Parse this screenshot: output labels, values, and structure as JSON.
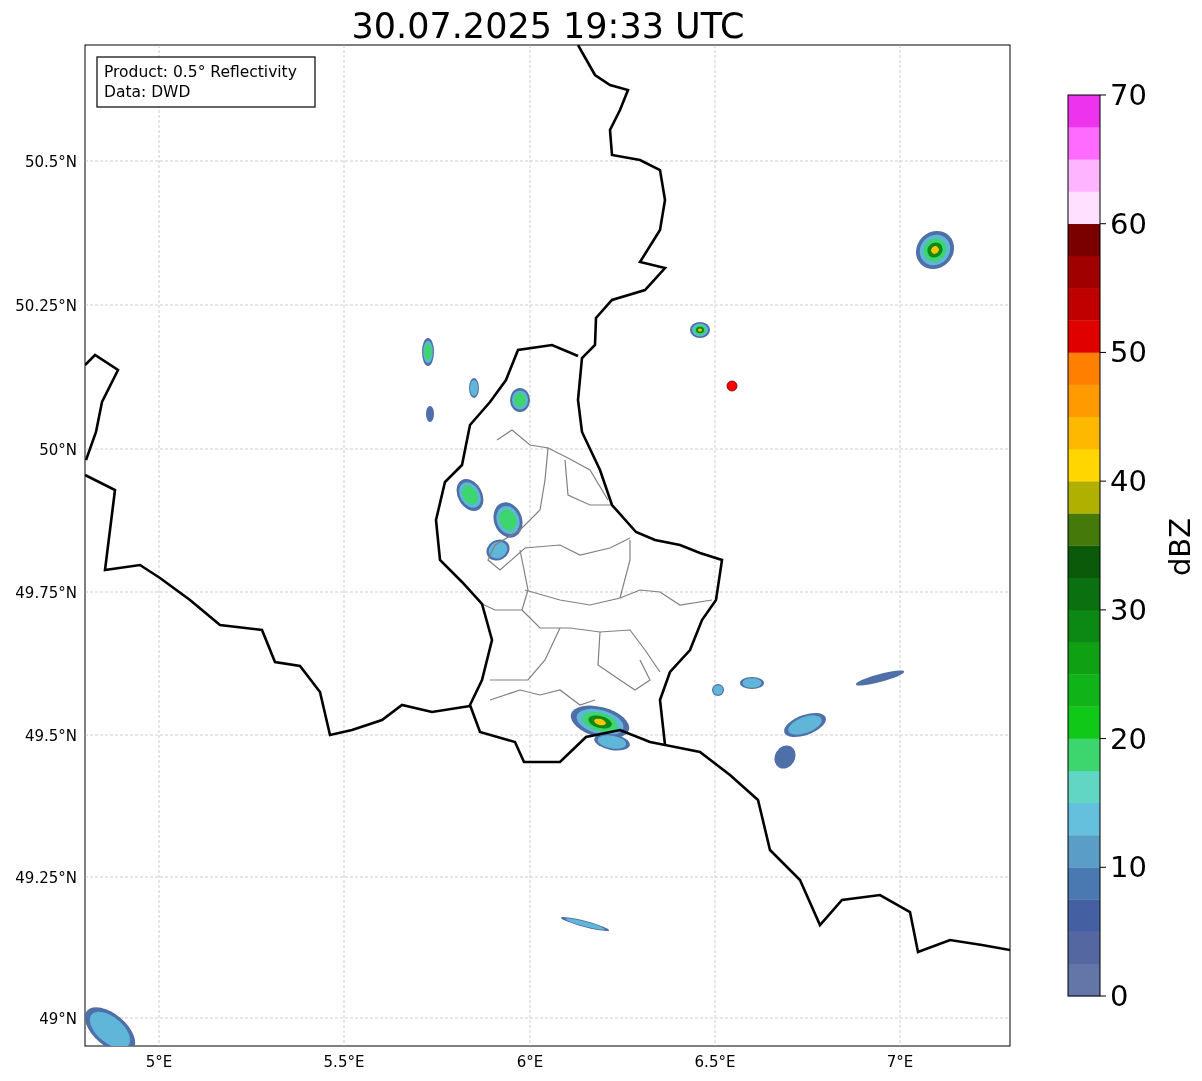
{
  "title": "30.07.2025 19:33 UTC",
  "info_box": {
    "lines": [
      "Product: 0.5° Reflectivity",
      "Data: DWD"
    ]
  },
  "map": {
    "lat_labels": [
      "50.5°N",
      "50.25°N",
      "50°N",
      "49.75°N",
      "49.5°N",
      "49.25°N",
      "49°N"
    ],
    "lon_labels": [
      "5°E",
      "5.5°E",
      "6°E",
      "6.5°E",
      "7°E"
    ]
  },
  "colorbar": {
    "label": "dBZ",
    "ticks": [
      "70",
      "60",
      "50",
      "40",
      "30",
      "20",
      "10",
      "0"
    ],
    "segments": [
      {
        "color": "#6476a8"
      },
      {
        "color": "#5467a0"
      },
      {
        "color": "#4460a3"
      },
      {
        "color": "#4a78b0"
      },
      {
        "color": "#5a9dc6"
      },
      {
        "color": "#64c0dc"
      },
      {
        "color": "#62d6c4"
      },
      {
        "color": "#3dd56e"
      },
      {
        "color": "#10c818"
      },
      {
        "color": "#10b418"
      },
      {
        "color": "#10a014"
      },
      {
        "color": "#0c8814"
      },
      {
        "color": "#0a7010"
      },
      {
        "color": "#0a5a0a"
      },
      {
        "color": "#457a0a"
      },
      {
        "color": "#b0b000"
      },
      {
        "color": "#ffd600"
      },
      {
        "color": "#ffb800"
      },
      {
        "color": "#ff9a00"
      },
      {
        "color": "#ff7f00"
      },
      {
        "color": "#e00000"
      },
      {
        "color": "#c00000"
      },
      {
        "color": "#a00000"
      },
      {
        "color": "#7a0000"
      },
      {
        "color": "#ffe0ff"
      },
      {
        "color": "#ffb4ff"
      },
      {
        "color": "#ff6aff"
      },
      {
        "color": "#ee33ee"
      }
    ]
  }
}
